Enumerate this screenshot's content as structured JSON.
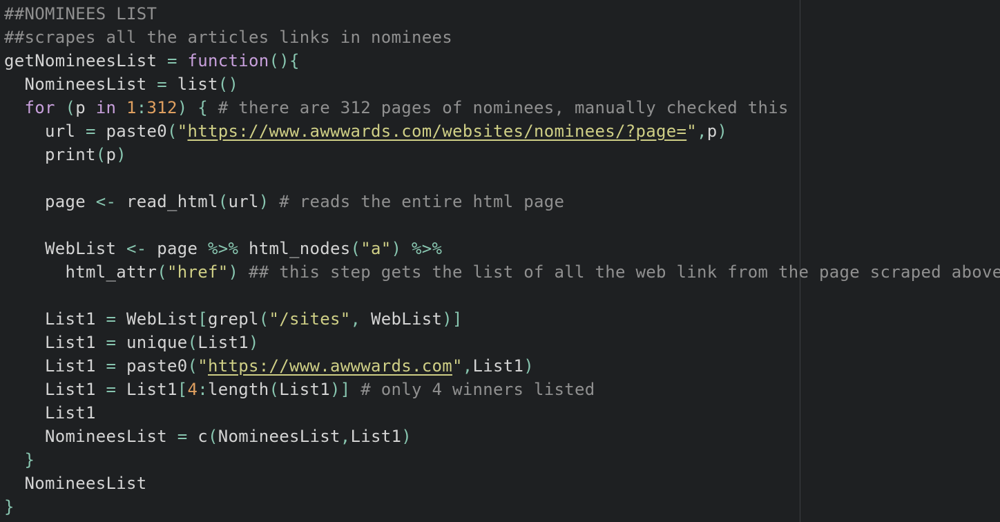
{
  "colors": {
    "background": "#1e2022",
    "plain": "#d4d4d4",
    "comment": "#909090",
    "keyword": "#c8a0dc",
    "operator": "#88c6b0",
    "number": "#e0a060",
    "string": "#cfcf86"
  },
  "lines": [
    [
      {
        "t": "comment",
        "v": "##NOMINEES LIST"
      }
    ],
    [
      {
        "t": "comment",
        "v": "##scrapes all the articles links in nominees"
      }
    ],
    [
      {
        "t": "plain",
        "v": "getNomineesList "
      },
      {
        "t": "op",
        "v": "="
      },
      {
        "t": "plain",
        "v": " "
      },
      {
        "t": "keyword",
        "v": "function"
      },
      {
        "t": "op",
        "v": "(){"
      }
    ],
    [
      {
        "t": "plain",
        "v": "  NomineesList "
      },
      {
        "t": "op",
        "v": "="
      },
      {
        "t": "plain",
        "v": " list"
      },
      {
        "t": "op",
        "v": "()"
      }
    ],
    [
      {
        "t": "plain",
        "v": "  "
      },
      {
        "t": "keyword",
        "v": "for"
      },
      {
        "t": "plain",
        "v": " "
      },
      {
        "t": "op",
        "v": "("
      },
      {
        "t": "plain",
        "v": "p "
      },
      {
        "t": "keyword",
        "v": "in"
      },
      {
        "t": "plain",
        "v": " "
      },
      {
        "t": "number",
        "v": "1"
      },
      {
        "t": "op",
        "v": ":"
      },
      {
        "t": "number",
        "v": "312"
      },
      {
        "t": "op",
        "v": ") {"
      },
      {
        "t": "plain",
        "v": " "
      },
      {
        "t": "comment",
        "v": "# there are 312 pages of nominees, manually checked this"
      }
    ],
    [
      {
        "t": "plain",
        "v": "    url "
      },
      {
        "t": "op",
        "v": "="
      },
      {
        "t": "plain",
        "v": " paste0"
      },
      {
        "t": "op",
        "v": "("
      },
      {
        "t": "string",
        "v": "\""
      },
      {
        "t": "link",
        "v": "https://www.awwwards.com/websites/nominees/?page="
      },
      {
        "t": "string",
        "v": "\""
      },
      {
        "t": "op",
        "v": ","
      },
      {
        "t": "plain",
        "v": "p"
      },
      {
        "t": "op",
        "v": ")"
      }
    ],
    [
      {
        "t": "plain",
        "v": "    print"
      },
      {
        "t": "op",
        "v": "("
      },
      {
        "t": "plain",
        "v": "p"
      },
      {
        "t": "op",
        "v": ")"
      }
    ],
    [],
    [
      {
        "t": "plain",
        "v": "    page "
      },
      {
        "t": "op",
        "v": "<-"
      },
      {
        "t": "plain",
        "v": " read_html"
      },
      {
        "t": "op",
        "v": "("
      },
      {
        "t": "plain",
        "v": "url"
      },
      {
        "t": "op",
        "v": ")"
      },
      {
        "t": "plain",
        "v": " "
      },
      {
        "t": "comment",
        "v": "# reads the entire html page"
      }
    ],
    [],
    [
      {
        "t": "plain",
        "v": "    WebList "
      },
      {
        "t": "op",
        "v": "<-"
      },
      {
        "t": "plain",
        "v": " page "
      },
      {
        "t": "op",
        "v": "%>%"
      },
      {
        "t": "plain",
        "v": " html_nodes"
      },
      {
        "t": "op",
        "v": "("
      },
      {
        "t": "string",
        "v": "\"a\""
      },
      {
        "t": "op",
        "v": ")"
      },
      {
        "t": "plain",
        "v": " "
      },
      {
        "t": "op",
        "v": "%>%"
      }
    ],
    [
      {
        "t": "plain",
        "v": "      html_attr"
      },
      {
        "t": "op",
        "v": "("
      },
      {
        "t": "string",
        "v": "\"href\""
      },
      {
        "t": "op",
        "v": ")"
      },
      {
        "t": "plain",
        "v": " "
      },
      {
        "t": "comment",
        "v": "## this step gets the list of all the web link from the page scraped above"
      }
    ],
    [],
    [
      {
        "t": "plain",
        "v": "    List1 "
      },
      {
        "t": "op",
        "v": "="
      },
      {
        "t": "plain",
        "v": " WebList"
      },
      {
        "t": "op",
        "v": "["
      },
      {
        "t": "plain",
        "v": "grepl"
      },
      {
        "t": "op",
        "v": "("
      },
      {
        "t": "string",
        "v": "\"/sites\""
      },
      {
        "t": "op",
        "v": ","
      },
      {
        "t": "plain",
        "v": " WebList"
      },
      {
        "t": "op",
        "v": ")]"
      }
    ],
    [
      {
        "t": "plain",
        "v": "    List1 "
      },
      {
        "t": "op",
        "v": "="
      },
      {
        "t": "plain",
        "v": " unique"
      },
      {
        "t": "op",
        "v": "("
      },
      {
        "t": "plain",
        "v": "List1"
      },
      {
        "t": "op",
        "v": ")"
      }
    ],
    [
      {
        "t": "plain",
        "v": "    List1 "
      },
      {
        "t": "op",
        "v": "="
      },
      {
        "t": "plain",
        "v": " paste0"
      },
      {
        "t": "op",
        "v": "("
      },
      {
        "t": "string",
        "v": "\""
      },
      {
        "t": "link",
        "v": "https://www.awwwards.com"
      },
      {
        "t": "string",
        "v": "\""
      },
      {
        "t": "op",
        "v": ","
      },
      {
        "t": "plain",
        "v": "List1"
      },
      {
        "t": "op",
        "v": ")"
      }
    ],
    [
      {
        "t": "plain",
        "v": "    List1 "
      },
      {
        "t": "op",
        "v": "="
      },
      {
        "t": "plain",
        "v": " List1"
      },
      {
        "t": "op",
        "v": "["
      },
      {
        "t": "number",
        "v": "4"
      },
      {
        "t": "op",
        "v": ":"
      },
      {
        "t": "plain",
        "v": "length"
      },
      {
        "t": "op",
        "v": "("
      },
      {
        "t": "plain",
        "v": "List1"
      },
      {
        "t": "op",
        "v": ")]"
      },
      {
        "t": "plain",
        "v": " "
      },
      {
        "t": "comment",
        "v": "# only 4 winners listed"
      }
    ],
    [
      {
        "t": "plain",
        "v": "    List1"
      }
    ],
    [
      {
        "t": "plain",
        "v": "    NomineesList "
      },
      {
        "t": "op",
        "v": "="
      },
      {
        "t": "plain",
        "v": " c"
      },
      {
        "t": "op",
        "v": "("
      },
      {
        "t": "plain",
        "v": "NomineesList"
      },
      {
        "t": "op",
        "v": ","
      },
      {
        "t": "plain",
        "v": "List1"
      },
      {
        "t": "op",
        "v": ")"
      }
    ],
    [
      {
        "t": "plain",
        "v": "  "
      },
      {
        "t": "op",
        "v": "}"
      }
    ],
    [
      {
        "t": "plain",
        "v": "  NomineesList"
      }
    ],
    [
      {
        "t": "op",
        "v": "}"
      }
    ]
  ]
}
